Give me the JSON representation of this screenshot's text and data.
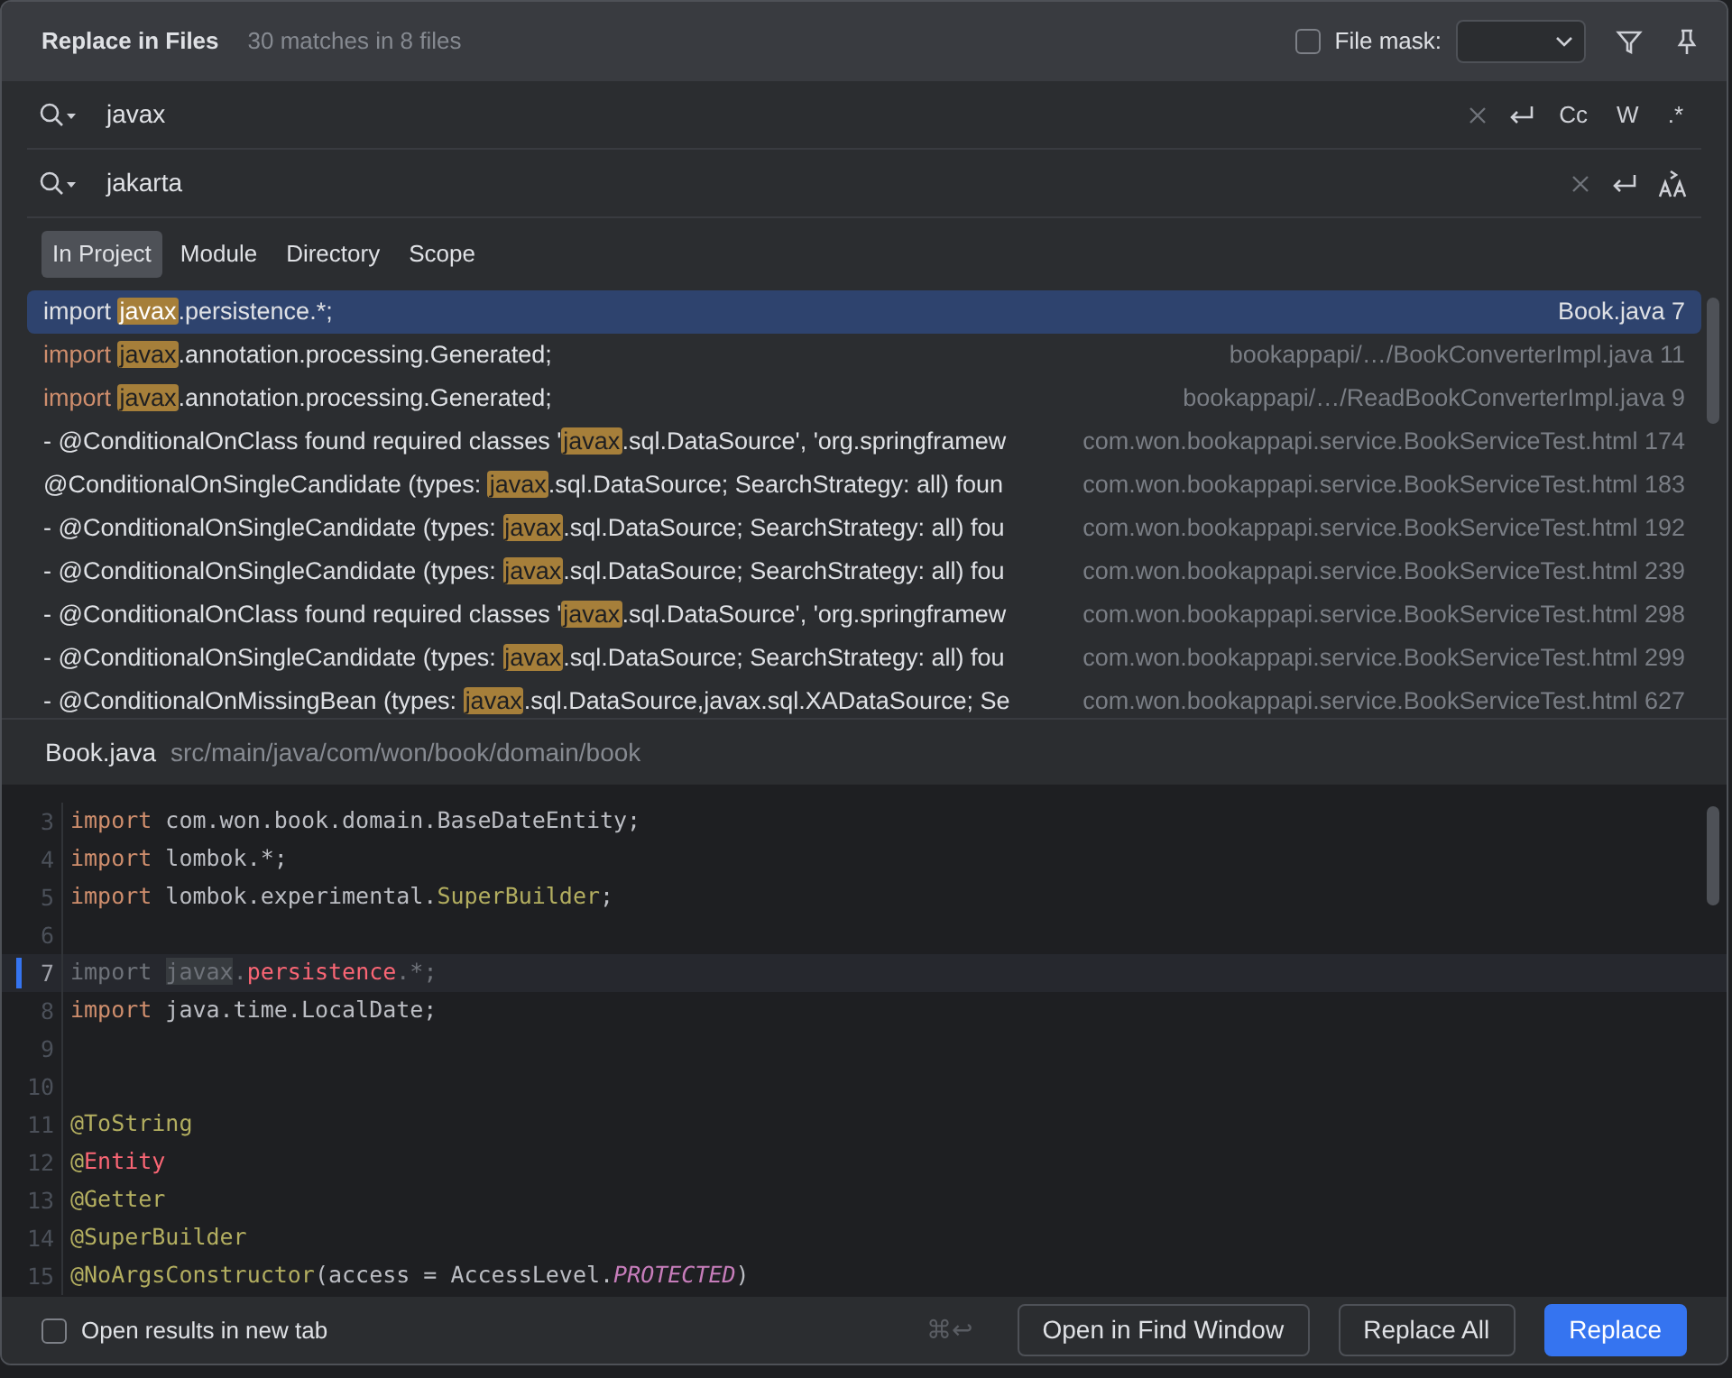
{
  "header": {
    "title": "Replace in Files",
    "summary": "30 matches in 8 files",
    "file_mask": {
      "label": "File mask:",
      "checked": false
    }
  },
  "find": {
    "value": "javax",
    "options": [
      "Cc",
      "W",
      ".*"
    ]
  },
  "replace": {
    "value": "jakarta"
  },
  "scopes": [
    {
      "label": "In Project",
      "selected": true
    },
    {
      "label": "Module",
      "selected": false
    },
    {
      "label": "Directory",
      "selected": false
    },
    {
      "label": "Scope",
      "selected": false
    }
  ],
  "results": [
    {
      "kind": "code",
      "selected": true,
      "lead": "import ",
      "match": "javax",
      "after": ".persistence.*;",
      "file": "Book.java 7"
    },
    {
      "kind": "code",
      "selected": false,
      "lead": "import ",
      "match": "javax",
      "after": ".annotation.processing.Generated;",
      "file": "bookappapi/…/BookConverterImpl.java 11"
    },
    {
      "kind": "code",
      "selected": false,
      "lead": "import ",
      "match": "javax",
      "after": ".annotation.processing.Generated;",
      "file": "bookappapi/…/ReadBookConverterImpl.java 9"
    },
    {
      "kind": "text",
      "selected": false,
      "before": "- @ConditionalOnClass found required classes '",
      "match": "javax",
      "after": ".sql.DataSource', 'org.springframew",
      "file": "com.won.bookappapi.service.BookServiceTest.html 174"
    },
    {
      "kind": "text",
      "selected": false,
      "before": "@ConditionalOnSingleCandidate (types: ",
      "match": "javax",
      "after": ".sql.DataSource; SearchStrategy: all) foun",
      "file": "com.won.bookappapi.service.BookServiceTest.html 183"
    },
    {
      "kind": "text",
      "selected": false,
      "before": "- @ConditionalOnSingleCandidate (types: ",
      "match": "javax",
      "after": ".sql.DataSource; SearchStrategy: all) fou",
      "file": "com.won.bookappapi.service.BookServiceTest.html 192"
    },
    {
      "kind": "text",
      "selected": false,
      "before": "- @ConditionalOnSingleCandidate (types: ",
      "match": "javax",
      "after": ".sql.DataSource; SearchStrategy: all) fou",
      "file": "com.won.bookappapi.service.BookServiceTest.html 239"
    },
    {
      "kind": "text",
      "selected": false,
      "before": "- @ConditionalOnClass found required classes '",
      "match": "javax",
      "after": ".sql.DataSource', 'org.springframew",
      "file": "com.won.bookappapi.service.BookServiceTest.html 298"
    },
    {
      "kind": "text",
      "selected": false,
      "before": "- @ConditionalOnSingleCandidate (types: ",
      "match": "javax",
      "after": ".sql.DataSource; SearchStrategy: all) fou",
      "file": "com.won.bookappapi.service.BookServiceTest.html 299"
    },
    {
      "kind": "text",
      "selected": false,
      "before": "- @ConditionalOnMissingBean (types: ",
      "match": "javax",
      "after": ".sql.DataSource,javax.sql.XADataSource; Se",
      "file": "com.won.bookappapi.service.BookServiceTest.html 627"
    }
  ],
  "preview": {
    "file": "Book.java",
    "path": "src/main/java/com/won/book/domain/book",
    "lines": [
      {
        "number": "3",
        "current": false,
        "tokens": [
          {
            "kind": "keyword",
            "text": "import"
          },
          {
            "kind": "plain",
            "text": " com.won.book.domain.BaseDateEntity;"
          }
        ]
      },
      {
        "number": "4",
        "current": false,
        "tokens": [
          {
            "kind": "keyword",
            "text": "import"
          },
          {
            "kind": "plain",
            "text": " lombok.*;"
          }
        ]
      },
      {
        "number": "5",
        "current": false,
        "tokens": [
          {
            "kind": "keyword",
            "text": "import"
          },
          {
            "kind": "plain",
            "text": " lombok.experimental."
          },
          {
            "kind": "annotation",
            "text": "SuperBuilder"
          },
          {
            "kind": "plain",
            "text": ";"
          }
        ]
      },
      {
        "number": "6",
        "current": false
      },
      {
        "number": "7",
        "current": true,
        "tokens": [
          {
            "kind": "unused",
            "text": "import "
          },
          {
            "kind": "match",
            "text": "javax"
          },
          {
            "kind": "unused",
            "text": "."
          },
          {
            "kind": "red",
            "text": "persistence"
          },
          {
            "kind": "unused",
            "text": ".*;"
          }
        ]
      },
      {
        "number": "8",
        "current": false,
        "tokens": [
          {
            "kind": "keyword",
            "text": "import"
          },
          {
            "kind": "plain",
            "text": " java.time.LocalDate;"
          }
        ]
      },
      {
        "number": "9",
        "current": false
      },
      {
        "number": "10",
        "current": false
      },
      {
        "number": "11",
        "current": false,
        "tokens": [
          {
            "kind": "annotation",
            "text": "@ToString"
          }
        ]
      },
      {
        "number": "12",
        "current": false,
        "tokens": [
          {
            "kind": "annotation",
            "text": "@"
          },
          {
            "kind": "red",
            "text": "Entity"
          }
        ]
      },
      {
        "number": "13",
        "current": false,
        "tokens": [
          {
            "kind": "annotation",
            "text": "@Getter"
          }
        ]
      },
      {
        "number": "14",
        "current": false,
        "tokens": [
          {
            "kind": "annotation",
            "text": "@SuperBuilder"
          }
        ]
      },
      {
        "number": "15",
        "current": false,
        "tokens": [
          {
            "kind": "annotation",
            "text": "@NoArgsConstructor"
          },
          {
            "kind": "plain",
            "text": "(access = AccessLevel."
          },
          {
            "kind": "constant",
            "text": "PROTECTED"
          },
          {
            "kind": "plain",
            "text": ")"
          }
        ]
      }
    ]
  },
  "footer": {
    "new_tab": {
      "label": "Open results in new tab",
      "checked": false
    },
    "shortcut": "⌘↩",
    "buttons": [
      {
        "label": "Open in Find Window",
        "primary": false
      },
      {
        "label": "Replace All",
        "primary": false
      },
      {
        "label": "Replace",
        "primary": true
      }
    ]
  }
}
